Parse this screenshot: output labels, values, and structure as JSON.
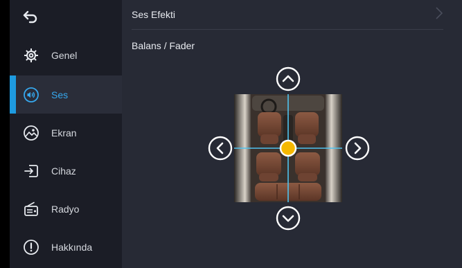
{
  "sidebar": {
    "back_icon": "back-arrow-icon",
    "items": [
      {
        "label": "Genel",
        "icon": "gear-icon",
        "active": false
      },
      {
        "label": "Ses",
        "icon": "speaker-icon",
        "active": true
      },
      {
        "label": "Ekran",
        "icon": "display-icon",
        "active": false
      },
      {
        "label": "Cihaz",
        "icon": "device-input-icon",
        "active": false
      },
      {
        "label": "Radyo",
        "icon": "radio-icon",
        "active": false
      },
      {
        "label": "Hakkında",
        "icon": "info-icon",
        "active": false
      }
    ]
  },
  "main": {
    "sound_effect_label": "Ses Efekti",
    "section_title": "Balans / Fader",
    "balance": 0,
    "fader": 0
  },
  "colors": {
    "accent": "#1e9be0",
    "active_text": "#36a8ee",
    "sidebar_bg": "#1b1d26",
    "main_bg": "#272a35",
    "crosshair": "#4fc3f0",
    "knob": "#f5b800"
  }
}
